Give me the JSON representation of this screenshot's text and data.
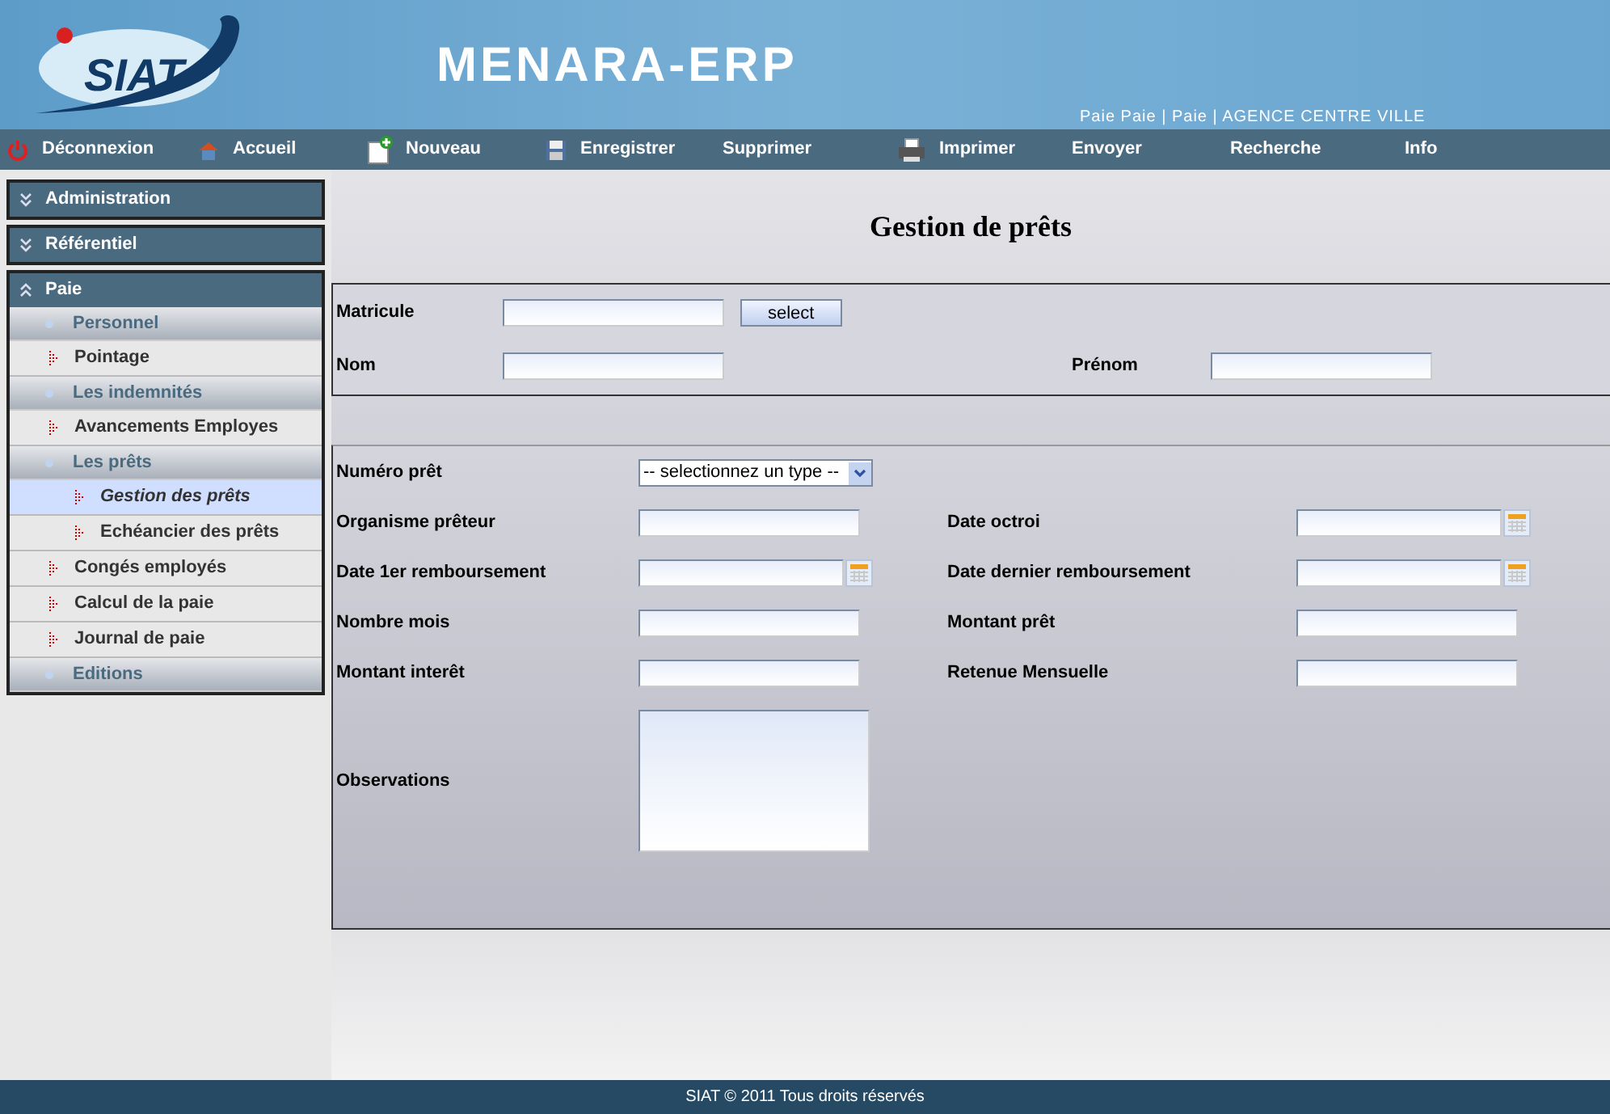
{
  "header": {
    "logo": "SIAT",
    "app_title": "MENARA-ERP",
    "user_info": "Paie Paie | Paie | AGENCE CENTRE VILLE"
  },
  "toolbar": [
    {
      "label": "Déconnexion"
    },
    {
      "label": "Accueil"
    },
    {
      "label": "Nouveau"
    },
    {
      "label": "Enregistrer"
    },
    {
      "label": "Supprimer"
    },
    {
      "label": "Imprimer"
    },
    {
      "label": "Envoyer"
    },
    {
      "label": "Recherche"
    },
    {
      "label": "Info"
    }
  ],
  "sidebar": {
    "sections": [
      {
        "label": "Administration",
        "expanded": false
      },
      {
        "label": "Référentiel",
        "expanded": false
      },
      {
        "label": "Paie",
        "expanded": true,
        "items": [
          {
            "kind": "group",
            "label": "Personnel"
          },
          {
            "kind": "link",
            "label": "Pointage",
            "selected": false
          },
          {
            "kind": "group",
            "label": "Les indemnités"
          },
          {
            "kind": "link",
            "label": "Avancements Employes",
            "selected": false
          },
          {
            "kind": "group",
            "label": "Les prêts",
            "children": [
              {
                "kind": "link",
                "label": "Gestion des prêts",
                "selected": true
              },
              {
                "kind": "link",
                "label": "Echéancier des prêts",
                "selected": false
              }
            ]
          },
          {
            "kind": "link",
            "label": "Congés employés",
            "selected": false
          },
          {
            "kind": "link",
            "label": "Calcul de la paie",
            "selected": false
          },
          {
            "kind": "link",
            "label": "Journal de paie",
            "selected": false
          },
          {
            "kind": "group",
            "label": "Editions"
          }
        ]
      }
    ]
  },
  "page_title": "Gestion de prêts",
  "employee_form": {
    "rows": [
      [
        {
          "label": "Matricule",
          "kind": "text",
          "button": "select"
        },
        null
      ],
      [
        {
          "label": "Nom",
          "kind": "text"
        },
        {
          "label": "Prénom",
          "kind": "text"
        }
      ]
    ]
  },
  "loan_form": {
    "rows": [
      [
        {
          "label": "Numéro prêt",
          "kind": "select",
          "value": "-- selectionnez un type --"
        },
        null
      ],
      [
        {
          "label": "Organisme prêteur",
          "kind": "text"
        },
        {
          "label": "Date octroi",
          "kind": "date"
        }
      ],
      [
        {
          "label": "Date 1er remboursement",
          "kind": "date"
        },
        {
          "label": "Date dernier remboursement",
          "kind": "date"
        }
      ],
      [
        {
          "label": "Nombre mois",
          "kind": "text"
        },
        {
          "label": "Montant prêt",
          "kind": "text"
        }
      ],
      [
        {
          "label": "Montant interêt",
          "kind": "text"
        },
        {
          "label": "Retenue Mensuelle",
          "kind": "text"
        }
      ],
      [
        {
          "label": "Observations",
          "kind": "textarea"
        },
        null
      ]
    ]
  },
  "footer": "SIAT © 2011 Tous droits réservés"
}
